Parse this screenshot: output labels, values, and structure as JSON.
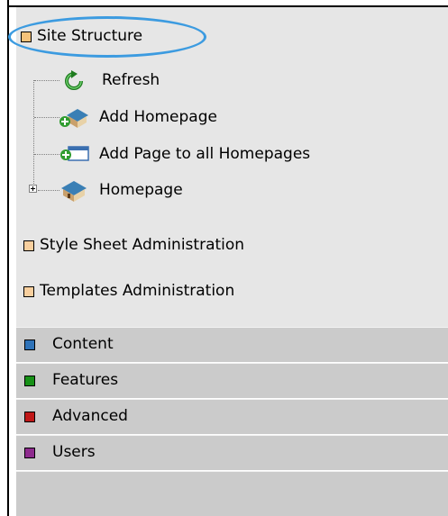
{
  "site_structure": {
    "label": "Site Structure",
    "color": "#f6c27a",
    "items": [
      {
        "label": "Refresh",
        "icon": "refresh-icon"
      },
      {
        "label": "Add Homepage",
        "icon": "add-homepage-icon"
      },
      {
        "label": "Add Page to all Homepages",
        "icon": "add-page-icon"
      },
      {
        "label": "Homepage",
        "icon": "homepage-icon"
      }
    ]
  },
  "sections": [
    {
      "label": "Style Sheet Administration",
      "color": "#f8cf9e"
    },
    {
      "label": "Templates Administration",
      "color": "#f8cf9e"
    }
  ],
  "bars": [
    {
      "label": "Content",
      "color": "#2f73b9"
    },
    {
      "label": "Features",
      "color": "#179117"
    },
    {
      "label": "Advanced",
      "color": "#c01818"
    },
    {
      "label": "Users",
      "color": "#8e2b8e"
    }
  ],
  "highlight_color": "#3c9be0"
}
